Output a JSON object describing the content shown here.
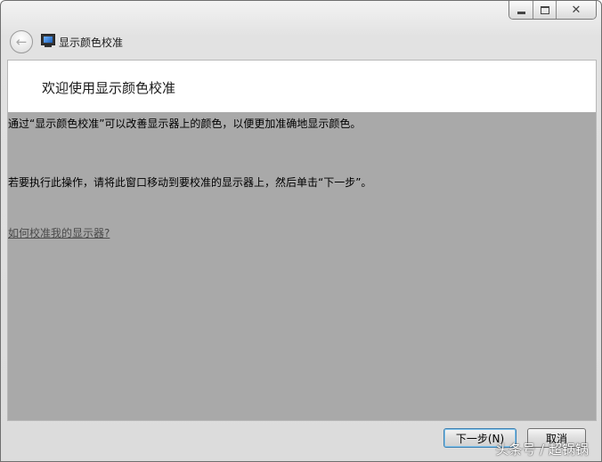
{
  "window": {
    "title": "显示颜色校准",
    "caption": {
      "minimize": "minimize-icon",
      "maximize": "maximize-icon",
      "close": "✕"
    }
  },
  "header": {
    "back_icon": "←"
  },
  "main": {
    "heading": "欢迎使用显示颜色校准",
    "paragraph1": "通过“显示颜色校准”可以改善显示器上的颜色，以便更加准确地显示颜色。",
    "paragraph2": "若要执行此操作，请将此窗口移动到要校准的显示器上，然后单击“下一步”。",
    "help_link": "如何校准我的显示器?"
  },
  "footer": {
    "next_label": "下一步(N)",
    "cancel_label": "取消"
  },
  "watermark": "头条号 / 超锅锅",
  "colors": {
    "content_gray": "#a9a9a9",
    "window_chrome": "#dcdcdc"
  }
}
